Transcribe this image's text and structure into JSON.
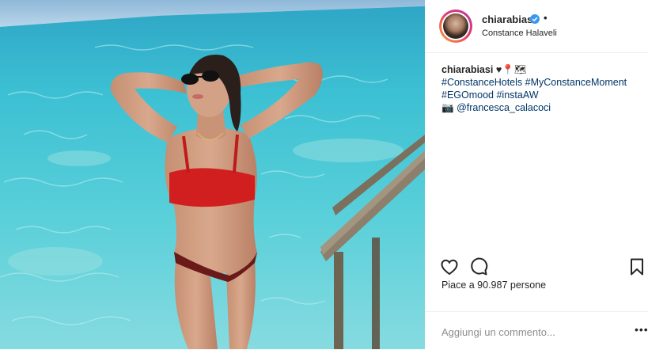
{
  "post": {
    "username": "chiarabiasi",
    "verified": true,
    "separator": "•",
    "location": "Constance Halaveli",
    "caption": {
      "user": "chiarabiasi",
      "emoji": "♥📍🗺",
      "hashtags_line1": "#ConstanceHotels #MyConstanceMoment",
      "hashtags_line2": "#EGOmood #instaAW",
      "credit_icon": "camera-emoji",
      "credit": "@francesca_calacoci"
    },
    "likes_text": "Piace a 90.987 persone",
    "comment_placeholder": "Aggiungi un commento...",
    "more_label": "•••"
  },
  "photo": {
    "alt": "Woman in red bikini and sunglasses standing in turquoise shallow sea next to wooden ladder"
  },
  "icons": {
    "like": "heart-icon",
    "comment": "comment-icon",
    "save": "bookmark-icon",
    "verified": "verified-badge-icon"
  },
  "colors": {
    "link": "#003569",
    "text": "#262626",
    "muted": "#8e8e8e",
    "verified": "#3897f0",
    "bikini": "#d11f1f"
  }
}
